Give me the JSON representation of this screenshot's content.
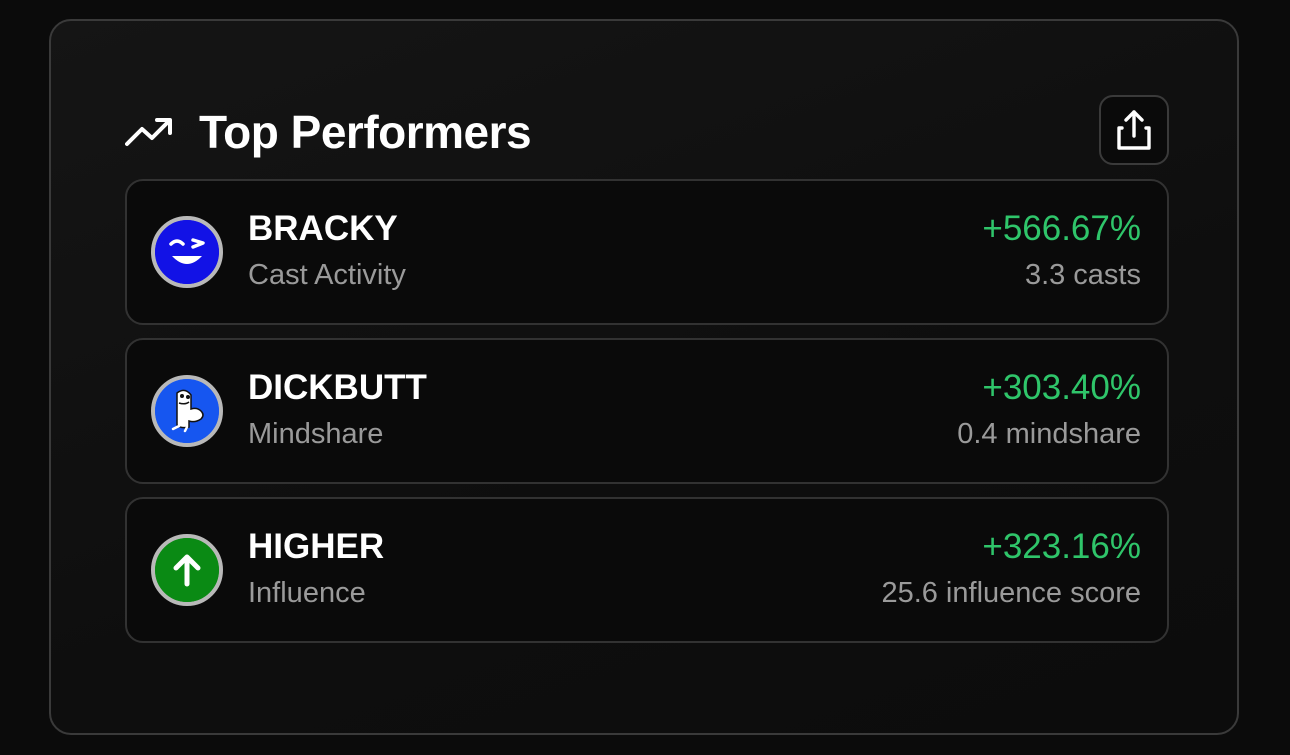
{
  "panel": {
    "title": "Top Performers",
    "title_icon": "trending-up-icon",
    "share_icon": "share-icon"
  },
  "performers": [
    {
      "name": "BRACKY",
      "metric": "Cast Activity",
      "change": "+566.67%",
      "value": "3.3 casts",
      "avatar_icon": "winking-face-icon",
      "avatar_color": "#1212e6"
    },
    {
      "name": "DICKBUTT",
      "metric": "Mindshare",
      "change": "+303.40%",
      "value": "0.4 mindshare",
      "avatar_icon": "cartoon-character-icon",
      "avatar_color": "#1656f0"
    },
    {
      "name": "HIGHER",
      "metric": "Influence",
      "change": "+323.16%",
      "value": "25.6 influence score",
      "avatar_icon": "arrow-up-icon",
      "avatar_color": "#0a8a14"
    }
  ],
  "colors": {
    "positive": "#2fc56a",
    "background": "#0b0b0b",
    "border": "#3a3a3a"
  }
}
